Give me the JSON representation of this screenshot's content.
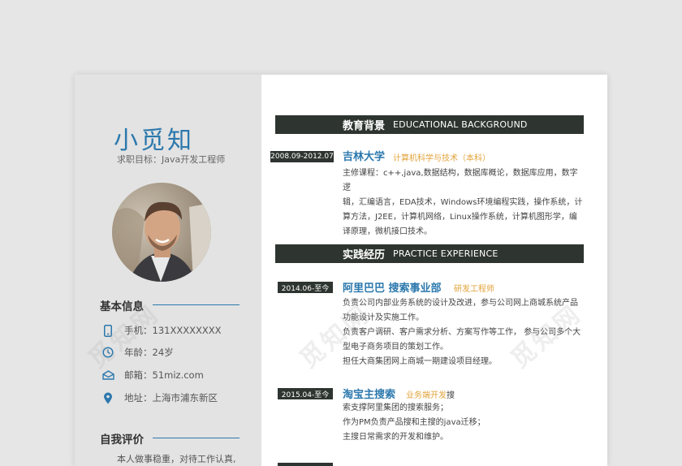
{
  "watermark": "觅知网",
  "profile": {
    "name": "小觅知",
    "objective": "求职目标：Java开发工程师"
  },
  "basic_info": {
    "title": "基本信息",
    "items": [
      {
        "icon": "phone-icon",
        "label": "手机：131XXXXXXXX"
      },
      {
        "icon": "age-icon",
        "label": "年龄：24岁"
      },
      {
        "icon": "mail-icon",
        "label": "邮箱：51miz.com"
      },
      {
        "icon": "location-icon",
        "label": "地址：上海市浦东新区"
      }
    ]
  },
  "self_eval": {
    "title": "自我评价",
    "text": "本人做事稳重，对待工作认真,"
  },
  "education": {
    "title_cn": "教育背景",
    "title_en": "EDUCATIONAL  BACKGROUND",
    "date": "2008.09-2012.07",
    "school": "吉林大学",
    "major": "计算机科学与技术（本科）",
    "lines": [
      "主修课程：c++,java,数据结构，数据库概论，数据库应用，数字逻",
      "辑，汇编语言，EDA技术，Windows环境编程实践，操作系统，计",
      "算方法，J2EE，计算机网络，Linux操作系统，计算机图形学，编",
      "译原理，微机接口技术。"
    ]
  },
  "practice": {
    "title_cn": "实践经历",
    "title_en": "PRACTICE EXPERIENCE",
    "jobs": [
      {
        "date": "2014.06-至今",
        "org": "阿里巴巴 搜索事业部",
        "role": "研发工程师",
        "lines": [
          "负责公司内部业务系统的设计及改进，参与公司网上商城系统产品",
          "功能设计及实施工作。",
          "负责客户调研、客户需求分析、方案写作等工作， 参与公司多个大",
          "型电子商务项目的策划工作。",
          "担任大商集团网上商城一期建设项目经理。"
        ]
      },
      {
        "date": "2015.04-至今",
        "org": "淘宝主搜索",
        "role": "业务端开发",
        "role_suffix": "搜",
        "lines": [
          "索支撑阿里集团的搜索服务；",
          "作为PM负责产品搜和主搜的java迁移；",
          "主搜日常需求的开发和维护。"
        ]
      }
    ]
  }
}
